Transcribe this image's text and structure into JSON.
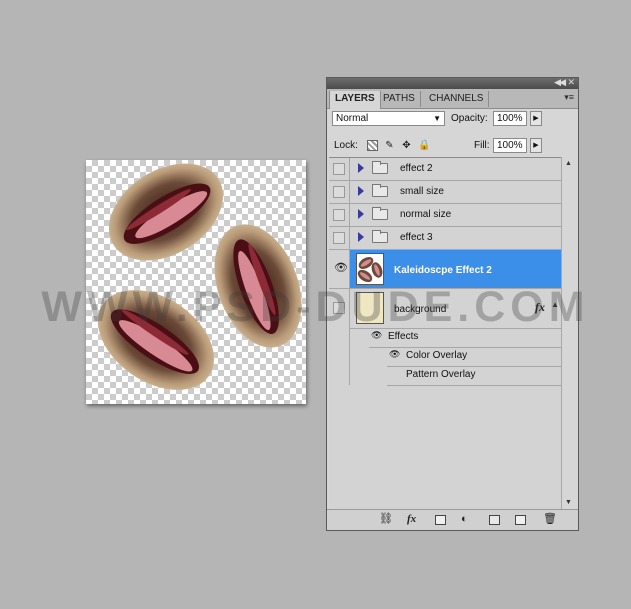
{
  "watermark": "WWW.PSD-DUDE.COM",
  "panel": {
    "tabs": [
      "LAYERS",
      "PATHS",
      "CHANNELS"
    ],
    "active_tab": "LAYERS",
    "blend_mode": "Normal",
    "opacity_label": "Opacity:",
    "opacity_value": "100%",
    "lock_label": "Lock:",
    "fill_label": "Fill:",
    "fill_value": "100%",
    "layers": [
      {
        "name": "effect 2",
        "type": "group",
        "visible": false
      },
      {
        "name": "small size",
        "type": "group",
        "visible": false
      },
      {
        "name": "normal size",
        "type": "group",
        "visible": false
      },
      {
        "name": "effect 3",
        "type": "group",
        "visible": false
      },
      {
        "name": "Kaleidoscpe Effect 2",
        "type": "layer",
        "visible": true,
        "selected": true
      },
      {
        "name": "background",
        "type": "layer",
        "visible": false,
        "has_fx": true
      }
    ],
    "effects_label": "Effects",
    "effects": [
      "Color Overlay",
      "Pattern Overlay"
    ]
  },
  "colors": {
    "selection": "#3b8fe8",
    "panel_bg": "#d6d6d6",
    "workspace_bg": "#b5b5b5"
  }
}
